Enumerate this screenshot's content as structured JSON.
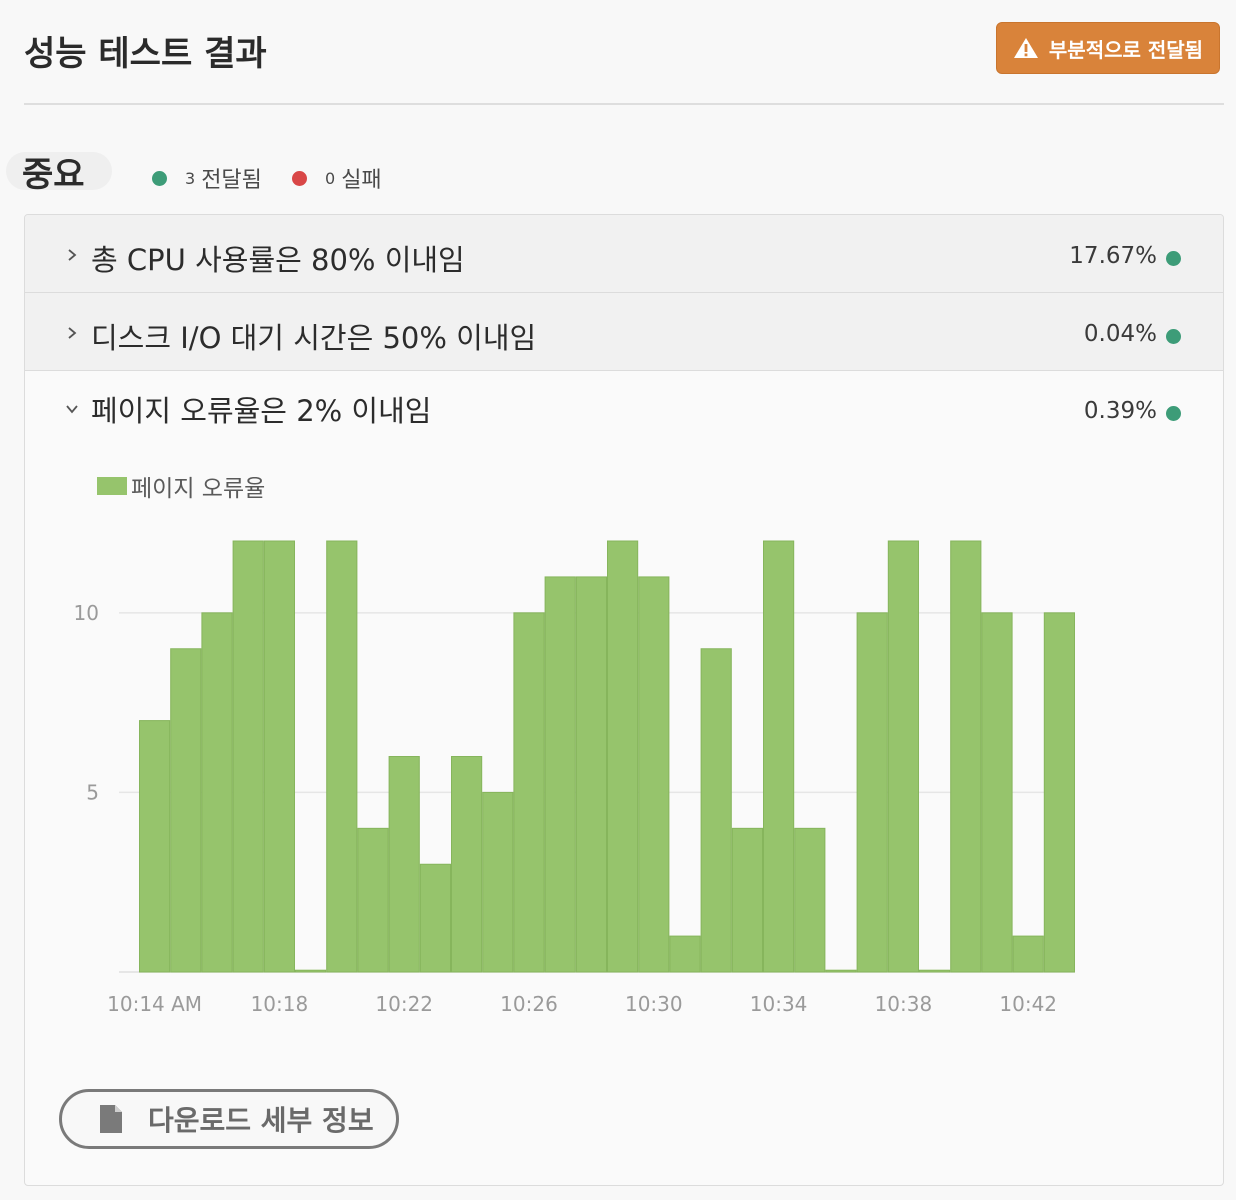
{
  "header": {
    "title": "성능 테스트 결과",
    "status_label": "부분적으로 전달됨",
    "status_color": "#d9833a",
    "status_icon": "warning-icon"
  },
  "section": {
    "title": "중요",
    "passed_count": "3",
    "passed_label": "전달됨",
    "passed_color": "#3d9c78",
    "failed_count": "0",
    "failed_label": "실패",
    "failed_color": "#d94747"
  },
  "checks": [
    {
      "label": "총 CPU 사용률은 80% 이내임",
      "value": "17.67%",
      "expanded": false,
      "icon": "chevron-right-icon"
    },
    {
      "label": "디스크 I/O 대기 시간은 50% 이내임",
      "value": "0.04%",
      "expanded": false,
      "icon": "chevron-right-icon"
    },
    {
      "label": "페이지 오류율은 2% 이내임",
      "value": "0.39%",
      "expanded": true,
      "icon": "chevron-down-icon"
    }
  ],
  "chart_data": {
    "type": "bar",
    "legend": [
      "페이지 오류율"
    ],
    "series": [
      {
        "name": "페이지 오류율",
        "color": "#96c46c",
        "values": [
          7,
          9,
          10,
          12,
          12,
          0.05,
          12,
          4,
          6,
          3,
          6,
          5,
          10,
          11,
          11,
          12,
          11,
          1,
          9,
          4,
          12,
          4,
          0.05,
          10,
          12,
          0.05,
          12,
          10,
          1,
          10
        ]
      }
    ],
    "y_ticks": [
      5,
      10
    ],
    "ylim": [
      0,
      12
    ],
    "x_tick_labels": [
      "10:14 AM",
      "10:18",
      "10:22",
      "10:26",
      "10:30",
      "10:34",
      "10:38",
      "10:42"
    ],
    "grid": true
  },
  "footer": {
    "download_label": "다운로드 세부 정보",
    "download_icon": "document-icon"
  }
}
